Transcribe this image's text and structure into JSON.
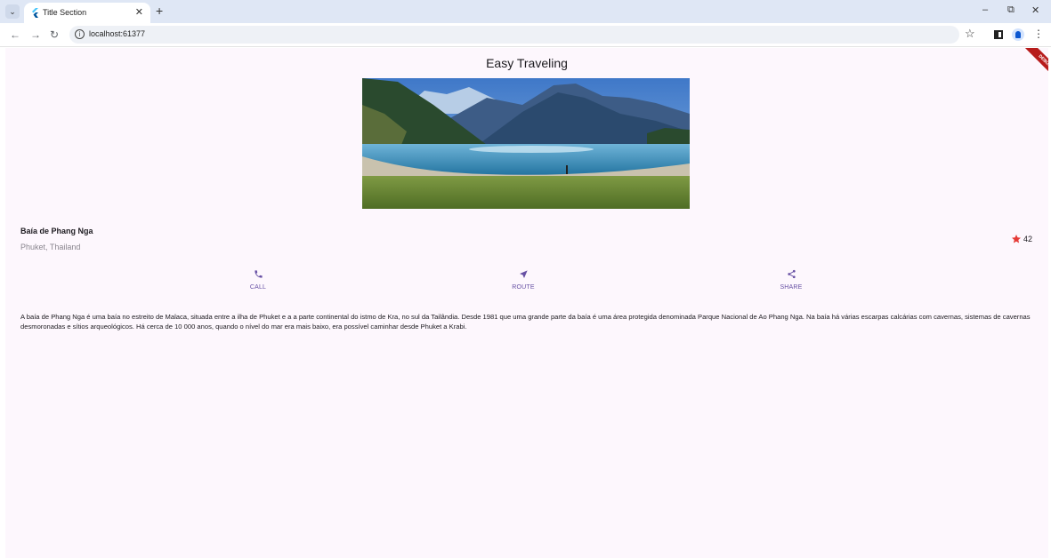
{
  "browser": {
    "tab_title": "Title Section",
    "url": "localhost:61377"
  },
  "app": {
    "title": "Easy Traveling",
    "debug_label": "DEBUG",
    "place": {
      "name": "Baía de Phang Nga",
      "location": "Phuket, Thailand",
      "favorite_count": "42"
    },
    "actions": [
      {
        "label": "CALL",
        "icon": "phone-icon"
      },
      {
        "label": "ROUTE",
        "icon": "navigation-icon"
      },
      {
        "label": "SHARE",
        "icon": "share-icon"
      }
    ],
    "description": "A baía de Phang Nga é uma baía no estreito de Malaca, situada entre a ilha de Phuket e a a parte continental do istmo de Kra, no sul da Tailândia. Desde 1981 que uma grande parte da baía é uma área protegida denominada Parque Nacional de Ao Phang Nga. Na baía há várias escarpas calcárias com cavernas, sistemas de cavernas desmoronadas e sítios arqueológicos. Há cerca de 10 000 anos, quando o nível do mar era mais baixo, era possível caminhar desde Phuket a Krabi.",
    "colors": {
      "accent": "#6750a4",
      "star": "#e53935",
      "background": "#fdf7fd"
    }
  }
}
